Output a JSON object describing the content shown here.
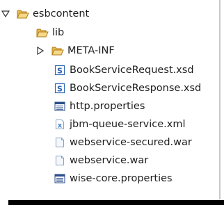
{
  "tree": {
    "root": {
      "label": "esbcontent",
      "icon": "folder-open-icon",
      "expanded": true
    },
    "items": [
      {
        "label": "lib",
        "icon": "folder-open-icon",
        "expandable": false
      },
      {
        "label": "META-INF",
        "icon": "folder-open-icon",
        "expandable": true,
        "expanded": false
      },
      {
        "label": "BookServiceRequest.xsd",
        "icon": "xsd-schema-file-icon"
      },
      {
        "label": "BookServiceResponse.xsd",
        "icon": "xsd-schema-file-icon"
      },
      {
        "label": "http.properties",
        "icon": "properties-file-icon"
      },
      {
        "label": "jbm-queue-service.xml",
        "icon": "xml-file-icon"
      },
      {
        "label": "webservice-secured.war",
        "icon": "generic-file-icon"
      },
      {
        "label": "webservice.war",
        "icon": "generic-file-icon"
      },
      {
        "label": "wise-core.properties",
        "icon": "properties-file-icon"
      }
    ]
  },
  "colors": {
    "folder": "#e8b850",
    "folder_stroke": "#b07d18",
    "xsd_badge": "#2f66b3",
    "properties_header": "#2a4e8a",
    "xml_badge": "#3f7fd0",
    "file_stroke": "#8aa0c0"
  }
}
